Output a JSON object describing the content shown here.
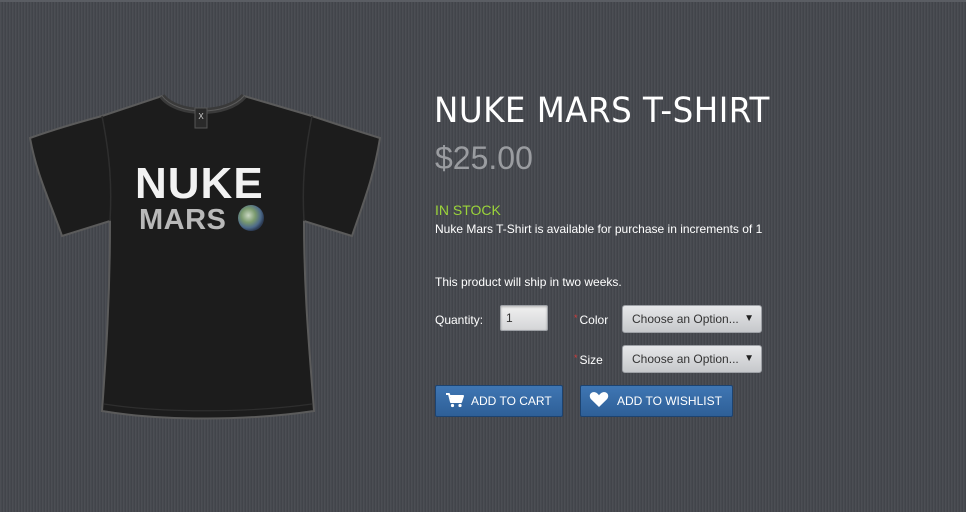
{
  "product": {
    "title": "NUKE MARS T-SHIRT",
    "price": "$25.00",
    "stock_status": "IN STOCK",
    "increments_note": "Nuke Mars T-Shirt is available for purchase in increments of 1",
    "shipping_note": "This product will ship in two weeks.",
    "image": {
      "line1": "NUKE",
      "line2": "MARS",
      "tag": "X"
    }
  },
  "form": {
    "quantity_label": "Quantity:",
    "quantity_value": "1",
    "color_label": "Color",
    "color_placeholder": "Choose an Option...",
    "size_label": "Size",
    "size_placeholder": "Choose an Option...",
    "required_marker": "*"
  },
  "actions": {
    "add_to_cart": "ADD TO CART",
    "add_to_wishlist": "ADD TO WISHLIST"
  },
  "colors": {
    "background": "#45484e",
    "stock_green": "#9bd43a",
    "button_blue": "#3469a6",
    "price_gray": "#9a9ca0"
  },
  "icons": {
    "cart": "cart-icon",
    "wishlist": "heart-icon",
    "dropdown": "chevron-down-icon"
  }
}
